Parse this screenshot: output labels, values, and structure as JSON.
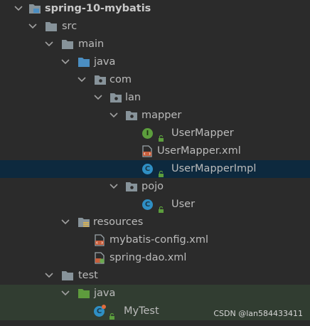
{
  "project_tree": {
    "root": "spring-10-mybatis",
    "src": "src",
    "main": "main",
    "java": "java",
    "com": "com",
    "lan": "lan",
    "mapper": "mapper",
    "user_mapper": "UserMapper",
    "user_mapper_xml": "UserMapper.xml",
    "user_mapper_impl": "UserMapperImpl",
    "pojo": "pojo",
    "user": "User",
    "resources": "resources",
    "mybatis_config": "mybatis-config.xml",
    "spring_dao": "spring-dao.xml",
    "test": "test",
    "test_java": "java",
    "my_test": "MyTest"
  },
  "watermark": "CSDN @lan584433411",
  "colors": {
    "background": "#2b2b2b",
    "selected_row": "#0d293e",
    "test_row": "#313d31",
    "folder": "#87939a",
    "source_folder": "#4b8ec2",
    "test_folder": "#5e9b3d",
    "class_icon": "#2f8fc4",
    "interface_icon": "#5c9e3d"
  }
}
